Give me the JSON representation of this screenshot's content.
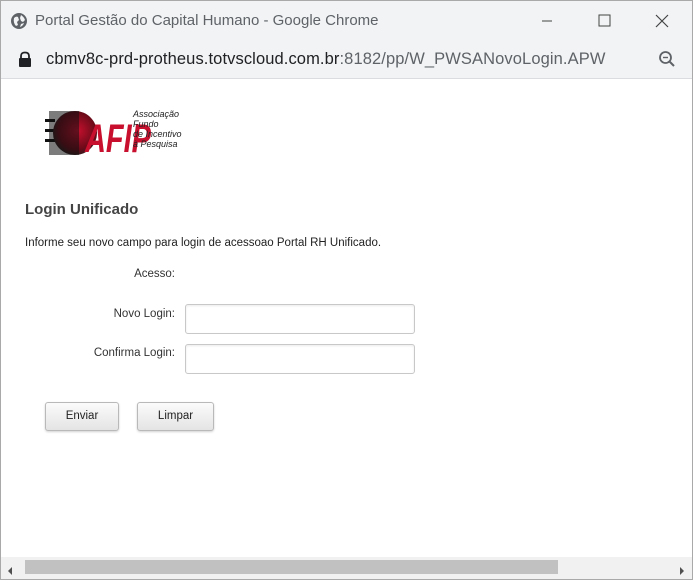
{
  "browser": {
    "window_title": "Portal Gestão do Capital Humano - Google Chrome",
    "url_host": "cbmv8c-prd-protheus.totvscloud.com.br",
    "url_rest": ":8182/pp/W_PWSANovoLogin.APW"
  },
  "logo": {
    "wordmark": "AFIP",
    "line1": "Associação",
    "line2": "Fundo",
    "line3": "de Incentivo",
    "line4": "à Pesquisa",
    "brand_color": "#c8102e"
  },
  "page": {
    "heading": "Login Unificado",
    "intro": "Informe seu novo campo para login de acessoao Portal RH Unificado."
  },
  "form": {
    "acesso_label": "Acesso:",
    "novo_login_label": "Novo Login:",
    "novo_login_value": "",
    "confirma_login_label": "Confirma Login:",
    "confirma_login_value": ""
  },
  "buttons": {
    "enviar": "Enviar",
    "limpar": "Limpar"
  }
}
